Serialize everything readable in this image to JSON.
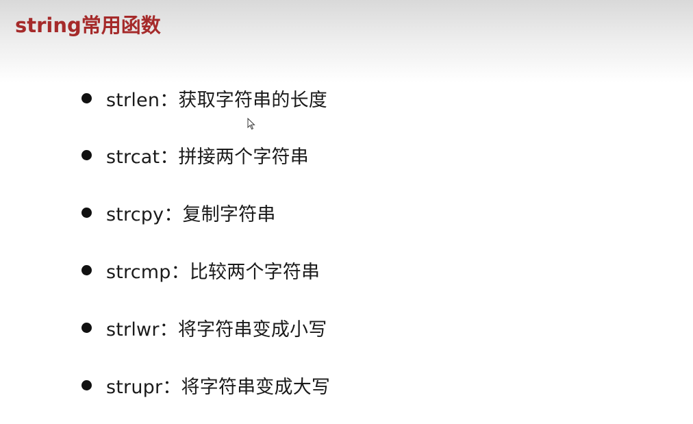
{
  "slide": {
    "title": "string常用函数",
    "title_color": "#a52a2a",
    "items": [
      {
        "text": "strlen：获取字符串的长度"
      },
      {
        "text": "strcat：拼接两个字符串"
      },
      {
        "text": "strcpy：复制字符串"
      },
      {
        "text": "strcmp：比较两个字符串"
      },
      {
        "text": "strlwr：将字符串变成小写"
      },
      {
        "text": "strupr：将字符串变成大写"
      }
    ]
  },
  "cursor_icon": "mouse-pointer-icon"
}
